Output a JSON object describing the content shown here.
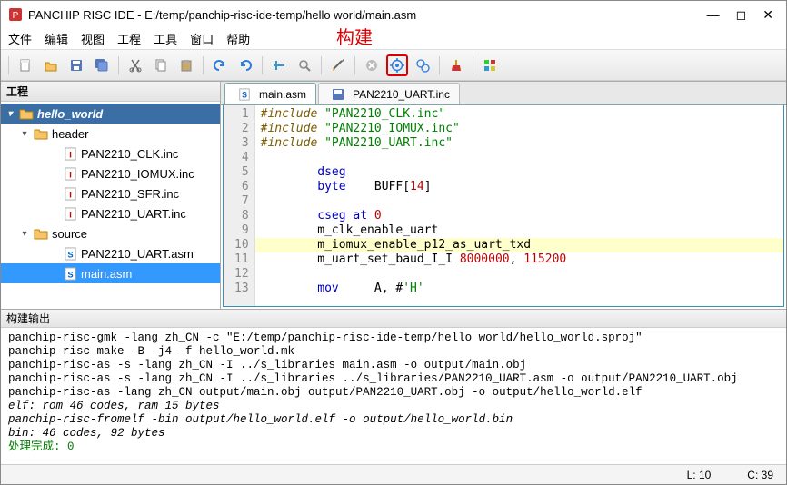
{
  "window": {
    "title": "PANCHIP RISC IDE - E:/temp/panchip-risc-ide-temp/hello world/main.asm"
  },
  "annotation": "构建",
  "menu": [
    "文件",
    "编辑",
    "视图",
    "工程",
    "工具",
    "窗口",
    "帮助"
  ],
  "left_panel": {
    "title": "工程",
    "root": "hello_world",
    "folders": [
      {
        "name": "header",
        "files": [
          "PAN2210_CLK.inc",
          "PAN2210_IOMUX.inc",
          "PAN2210_SFR.inc",
          "PAN2210_UART.inc"
        ],
        "badge": "I",
        "badge_color": "#c00"
      },
      {
        "name": "source",
        "files": [
          "PAN2210_UART.asm",
          "main.asm"
        ],
        "badge": "S",
        "badge_color": "#06c"
      }
    ],
    "selected": "main.asm"
  },
  "tabs": [
    {
      "label": "main.asm",
      "icon": "S",
      "active": true
    },
    {
      "label": "PAN2210_UART.inc",
      "icon": "save",
      "active": false
    }
  ],
  "editor": {
    "lines": [
      {
        "n": 1,
        "segs": [
          [
            "pp",
            "#include "
          ],
          [
            "str",
            "\"PAN2210_CLK.inc\""
          ]
        ]
      },
      {
        "n": 2,
        "segs": [
          [
            "pp",
            "#include "
          ],
          [
            "str",
            "\"PAN2210_IOMUX.inc\""
          ]
        ]
      },
      {
        "n": 3,
        "segs": [
          [
            "pp",
            "#include "
          ],
          [
            "str",
            "\"PAN2210_UART.inc\""
          ]
        ]
      },
      {
        "n": 4,
        "segs": []
      },
      {
        "n": 5,
        "segs": [
          [
            "",
            "        "
          ],
          [
            "blue",
            "dseg"
          ]
        ]
      },
      {
        "n": 6,
        "segs": [
          [
            "",
            "        "
          ],
          [
            "blue",
            "byte"
          ],
          [
            "",
            "    BUFF["
          ],
          [
            "num",
            "14"
          ],
          [
            "",
            "]"
          ]
        ]
      },
      {
        "n": 7,
        "segs": []
      },
      {
        "n": 8,
        "segs": [
          [
            "",
            "        "
          ],
          [
            "blue",
            "cseg at"
          ],
          [
            "",
            " "
          ],
          [
            "num",
            "0"
          ]
        ]
      },
      {
        "n": 9,
        "segs": [
          [
            "",
            "        m_clk_enable_uart"
          ]
        ]
      },
      {
        "n": 10,
        "hl": true,
        "segs": [
          [
            "",
            "        m_iomux_enable_p12_as_uart_txd"
          ]
        ]
      },
      {
        "n": 11,
        "segs": [
          [
            "",
            "        m_uart_set_baud_I_I "
          ],
          [
            "num",
            "8000000"
          ],
          [
            "",
            ", "
          ],
          [
            "num",
            "115200"
          ]
        ]
      },
      {
        "n": 12,
        "segs": []
      },
      {
        "n": 13,
        "segs": [
          [
            "",
            "        "
          ],
          [
            "blue",
            "mov"
          ],
          [
            "",
            "     A, #"
          ],
          [
            "str",
            "'H'"
          ]
        ]
      }
    ]
  },
  "output": {
    "title": "构建输出",
    "lines": [
      "panchip-risc-gmk -lang zh_CN -c \"E:/temp/panchip-risc-ide-temp/hello world/hello_world.sproj\"",
      "panchip-risc-make -B -j4 -f hello_world.mk",
      "panchip-risc-as -s -lang zh_CN -I ../s_libraries main.asm -o output/main.obj",
      "panchip-risc-as -s -lang zh_CN -I ../s_libraries ../s_libraries/PAN2210_UART.asm -o output/PAN2210_UART.obj",
      "panchip-risc-as -lang zh_CN output/main.obj output/PAN2210_UART.obj -o output/hello_world.elf"
    ],
    "italic_lines": [
      "elf: rom 46 codes, ram 15 bytes",
      "panchip-risc-fromelf -bin output/hello_world.elf -o output/hello_world.bin",
      "bin: 46 codes, 92 bytes"
    ],
    "done": "处理完成: 0"
  },
  "status": {
    "line_label": "L:",
    "line": "10",
    "col_label": "C:",
    "col": "39"
  }
}
